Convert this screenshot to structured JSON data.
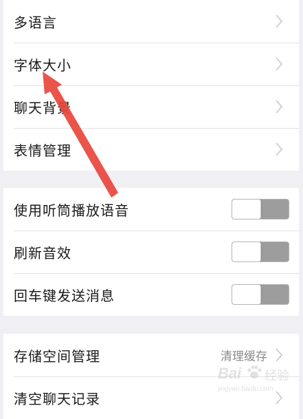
{
  "groups": [
    {
      "rows": [
        {
          "label": "多语言",
          "type": "nav"
        },
        {
          "label": "字体大小",
          "type": "nav"
        },
        {
          "label": "聊天背景",
          "type": "nav"
        },
        {
          "label": "表情管理",
          "type": "nav"
        }
      ]
    },
    {
      "rows": [
        {
          "label": "使用听筒播放语音",
          "type": "toggle",
          "on": false
        },
        {
          "label": "刷新音效",
          "type": "toggle",
          "on": false
        },
        {
          "label": "回车键发送消息",
          "type": "toggle",
          "on": false
        }
      ]
    },
    {
      "rows": [
        {
          "label": "存储空间管理",
          "type": "nav",
          "value": "清理缓存"
        },
        {
          "label": "清空聊天记录",
          "type": "nav"
        }
      ]
    }
  ],
  "watermark": {
    "brand": "Bai",
    "brand2": "经验",
    "url": "jingyan.baidu.com"
  },
  "colors": {
    "background": "#efeff4",
    "row": "#ffffff",
    "arrow": "#e8453c",
    "toggle_off": "#9d9d9d"
  },
  "icons": {
    "chevron": "chevron-right-icon",
    "annotation": "red-arrow-annotation"
  }
}
